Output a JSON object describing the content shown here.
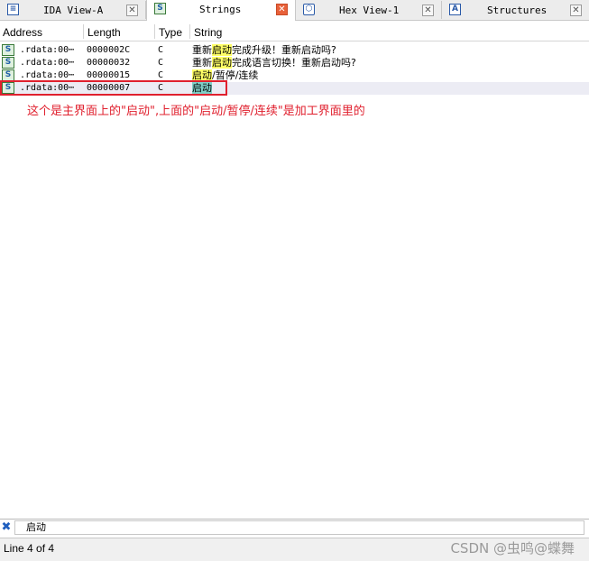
{
  "tabs": [
    {
      "label": "IDA View-A",
      "icon": "document-list-icon",
      "active": false
    },
    {
      "label": "Strings",
      "icon": "string-icon",
      "active": true
    },
    {
      "label": "Hex View-1",
      "icon": "hex-icon",
      "active": false
    },
    {
      "label": "Structures",
      "icon": "structure-icon",
      "active": false
    }
  ],
  "columns": {
    "address": "Address",
    "length": "Length",
    "type": "Type",
    "string": "String"
  },
  "rows": [
    {
      "address": ".rdata:00⋯",
      "length": "0000002C",
      "type": "C",
      "string_pre": "重新",
      "string_match": "启动",
      "string_post": "完成升级！重新启动吗?"
    },
    {
      "address": ".rdata:00⋯",
      "length": "00000032",
      "type": "C",
      "string_pre": "重新",
      "string_match": "启动",
      "string_post": "完成语言切换！重新启动吗?"
    },
    {
      "address": ".rdata:00⋯",
      "length": "00000015",
      "type": "C",
      "string_pre": "",
      "string_match": "启动",
      "string_post": "/暂停/连续"
    },
    {
      "address": ".rdata:00⋯",
      "length": "00000007",
      "type": "C",
      "string_pre": "",
      "string_match": "启动",
      "string_post": ""
    }
  ],
  "annotation": {
    "text": "这个是主界面上的\"启动\",上面的\"启动/暂停/连续\"是加工界面里的",
    "color": "#e0202e"
  },
  "filter": {
    "value": "启动"
  },
  "status": {
    "line_text": "Line 4 of 4"
  },
  "watermark": "CSDN @虫鸣@蝶舞",
  "colors": {
    "highlight": "#ffff66",
    "selected_highlight": "#7fd0c8",
    "active_close": "#e8613a"
  }
}
